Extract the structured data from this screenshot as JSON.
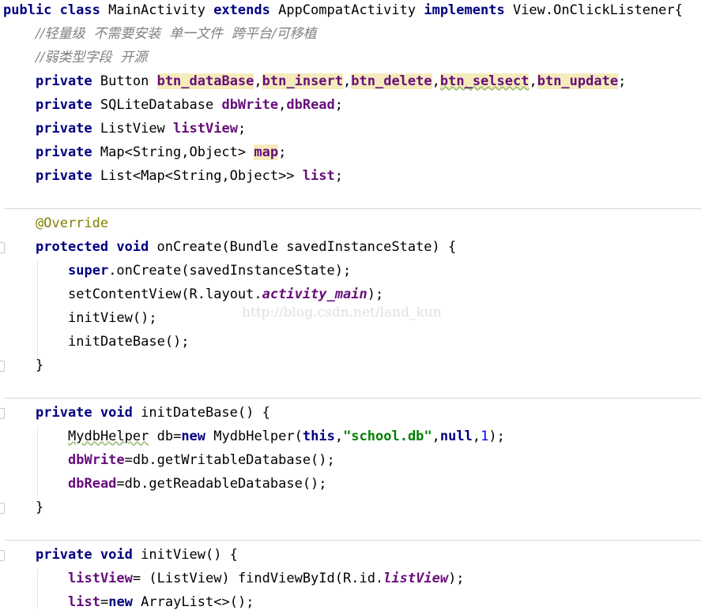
{
  "watermark": "http://blog.csdn.net/land_kun",
  "code": {
    "class_decl": {
      "kw_public": "public",
      "kw_class": "class",
      "class_name": "MainActivity",
      "kw_extends": "extends",
      "super_class": "AppCompatActivity",
      "kw_implements": "implements",
      "interface": "View.OnClickListener{"
    },
    "comment1": "//轻量级  不需要安装  单一文件  跨平台/可移植",
    "comment2": "//弱类型字段  开源",
    "buttons_decl": {
      "kw": "private",
      "type": "Button",
      "f1": "btn_dataBase",
      "f2": "btn_insert",
      "f3": "btn_delete",
      "f4": "btn_selsect",
      "f5": "btn_update",
      "end": ";"
    },
    "db_decl": {
      "kw": "private",
      "type": "SQLiteDatabase",
      "f1": "dbWrite",
      "f2": "dbRead",
      "end": ";"
    },
    "listview_decl": {
      "kw": "private",
      "type": "ListView",
      "f1": "listView",
      "end": ";"
    },
    "map_decl": {
      "kw": "private",
      "type": "Map<String,Object>",
      "f1": "map",
      "end": ";"
    },
    "list_decl": {
      "kw": "private",
      "type": "List<Map<String,Object>>",
      "f1": "list",
      "end": ";"
    },
    "annotation": "@Override",
    "oncreate": {
      "kw": "protected void",
      "sig": "onCreate(Bundle savedInstanceState) {"
    },
    "super_call": {
      "kw": "super",
      "rest": ".onCreate(savedInstanceState);"
    },
    "setcontent": {
      "pre": "setContentView(R.layout.",
      "static": "activity_main",
      "post": ");"
    },
    "initview_call": "initView();",
    "initdb_call": "initDateBase();",
    "close1": "}",
    "initdb_method": {
      "kw": "private void",
      "sig": "initDateBase() {"
    },
    "helper_line": {
      "type": "MydbHelper",
      "mid": " db=",
      "kw_new": "new",
      "ctor": " MydbHelper(",
      "kw_this": "this",
      "comma1": ",",
      "str": "\"school.db\"",
      "comma2": ",",
      "kw_null": "null",
      "comma3": ",",
      "num": "1",
      "end": ");"
    },
    "dbwrite_line": {
      "fld": "dbWrite",
      "rest": "=db.getWritableDatabase();"
    },
    "dbread_line": {
      "fld": "dbRead",
      "rest": "=db.getReadableDatabase();"
    },
    "close2": "}",
    "initview_method": {
      "kw": "private void",
      "sig": "initView() {"
    },
    "listview_line": {
      "fld": "listView",
      "mid": "= (ListView) findViewById(R.id.",
      "static": "listView",
      "end": ");"
    },
    "list_line": {
      "fld": "list",
      "eq": "=",
      "kw_new": "new",
      "rest": " ArrayList<>();"
    }
  }
}
